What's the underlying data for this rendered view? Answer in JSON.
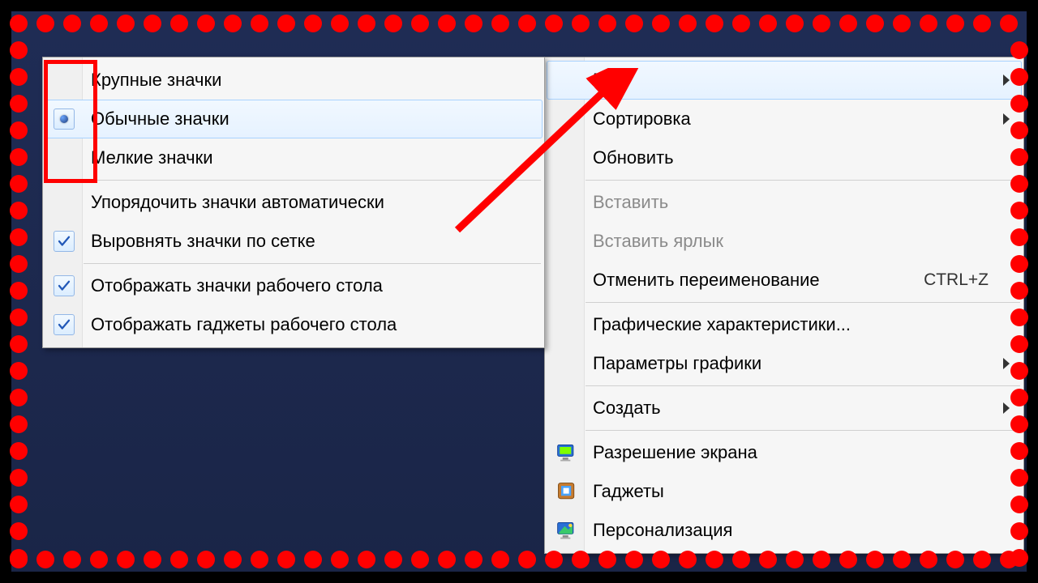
{
  "annotation": {
    "dot_color": "#ff0000",
    "arrow_color": "#ff0000"
  },
  "main_menu": {
    "items": [
      {
        "label": "Вид",
        "submenu": true,
        "highlight": true
      },
      {
        "label": "Сортировка",
        "submenu": true
      },
      {
        "label": "Обновить"
      },
      {
        "sep": true
      },
      {
        "label": "Вставить",
        "disabled": true
      },
      {
        "label": "Вставить ярлык",
        "disabled": true
      },
      {
        "label": "Отменить переименование",
        "shortcut": "CTRL+Z"
      },
      {
        "sep": true
      },
      {
        "label": "Графические характеристики..."
      },
      {
        "label": "Параметры графики",
        "submenu": true
      },
      {
        "sep": true
      },
      {
        "label": "Создать",
        "submenu": true
      },
      {
        "sep": true
      },
      {
        "label": "Разрешение экрана",
        "icon": "screen-resolution-icon"
      },
      {
        "label": "Гаджеты",
        "icon": "gadgets-icon"
      },
      {
        "label": "Персонализация",
        "icon": "personalization-icon"
      }
    ]
  },
  "view_submenu": {
    "items": [
      {
        "label": "Крупные значки",
        "radio": false
      },
      {
        "label": "Обычные значки",
        "radio": true,
        "highlight": true
      },
      {
        "label": "Мелкие значки",
        "radio": false
      },
      {
        "sep": true
      },
      {
        "label": "Упорядочить значки автоматически",
        "check": false
      },
      {
        "label": "Выровнять значки по сетке",
        "check": true
      },
      {
        "sep": true
      },
      {
        "label": "Отображать значки рабочего стола",
        "check": true
      },
      {
        "label": "Отображать гаджеты  рабочего стола",
        "check": true
      }
    ]
  }
}
